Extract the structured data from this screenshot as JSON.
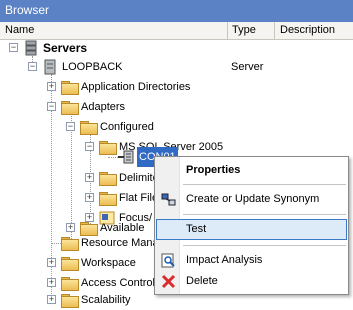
{
  "window": {
    "title": "Browser"
  },
  "columns": {
    "name": "Name",
    "type": "Type",
    "description": "Description"
  },
  "tree": {
    "servers": "Servers",
    "loopback": "LOOPBACK",
    "loopback_type": "Server",
    "application_directories": "Application Directories",
    "adapters": "Adapters",
    "configured": "Configured",
    "ms_sql_server": "MS SQL Server 2005",
    "connection": "CON01",
    "delimited": "Delimite",
    "flat_file": "Flat File",
    "focus": "Focus/",
    "available": "Available",
    "resource_management": "Resource Mana",
    "workspace": "Workspace",
    "access_control": "Access Control",
    "scalability": "Scalability"
  },
  "context_menu": {
    "properties": "Properties",
    "create_update_synonym": "Create or Update Synonym",
    "test": "Test",
    "impact_analysis": "Impact Analysis",
    "delete": "Delete"
  }
}
